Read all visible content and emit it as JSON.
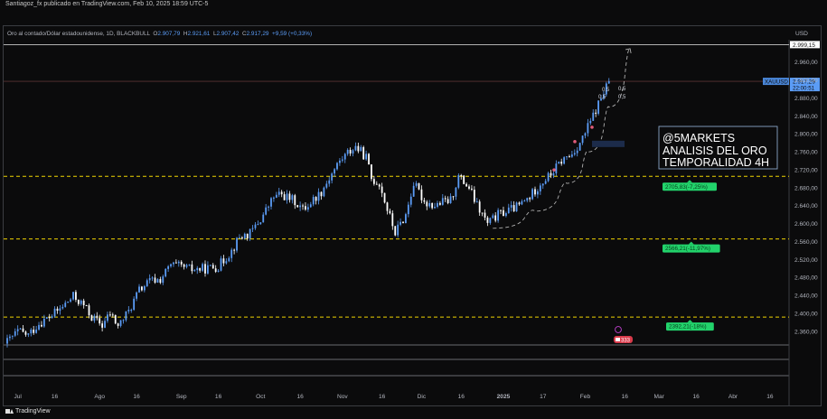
{
  "header": {
    "credit": "Santiagoz_fx publicado en TradingView.com, Feb 10, 2025 18:59 UTC-5"
  },
  "legend": {
    "symbol": "Oro al contado/Dólar estadounidense, 1D, BLACKBULL",
    "open_label": "O",
    "open": "2.907,79",
    "high_label": "H",
    "high": "2.921,61",
    "low_label": "L",
    "low": "2.907,42",
    "close_label": "C",
    "close": "2.917,29",
    "change": "+9,59 (+0,33%)"
  },
  "footer": {
    "brand": "TradingView"
  },
  "chart_data": {
    "type": "candlestick",
    "currency": "USD",
    "ylim": [
      2330,
      3010
    ],
    "y_ticks": [
      {
        "value": 2360,
        "label": "2.360,00"
      },
      {
        "value": 2400,
        "label": "2.400,00"
      },
      {
        "value": 2440,
        "label": "2.440,00"
      },
      {
        "value": 2480,
        "label": "2.480,00"
      },
      {
        "value": 2520,
        "label": "2.520,00"
      },
      {
        "value": 2560,
        "label": "2.560,00"
      },
      {
        "value": 2600,
        "label": "2.600,00"
      },
      {
        "value": 2640,
        "label": "2.640,00"
      },
      {
        "value": 2680,
        "label": "2.680,00"
      },
      {
        "value": 2720,
        "label": "2.720,00"
      },
      {
        "value": 2760,
        "label": "2.760,00"
      },
      {
        "value": 2800,
        "label": "2.800,00"
      },
      {
        "value": 2840,
        "label": "2.840,00"
      },
      {
        "value": 2880,
        "label": "2.880,00"
      },
      {
        "value": 2920,
        "label": "2.920,00"
      },
      {
        "value": 2960,
        "label": "2.960,00"
      }
    ],
    "x_ticks": [
      {
        "day": 4,
        "label": "Jul"
      },
      {
        "day": 18,
        "label": "16"
      },
      {
        "day": 35,
        "label": "Ago"
      },
      {
        "day": 49,
        "label": "16"
      },
      {
        "day": 66,
        "label": "Sep"
      },
      {
        "day": 80,
        "label": "16"
      },
      {
        "day": 96,
        "label": "Oct"
      },
      {
        "day": 111,
        "label": "16"
      },
      {
        "day": 127,
        "label": "Nov"
      },
      {
        "day": 142,
        "label": "16"
      },
      {
        "day": 157,
        "label": "Dic"
      },
      {
        "day": 172,
        "label": "16"
      },
      {
        "day": 188,
        "label": "2025"
      },
      {
        "day": 203,
        "label": "17"
      },
      {
        "day": 219,
        "label": "Feb"
      },
      {
        "day": 234,
        "label": "16"
      },
      {
        "day": 247,
        "label": "Mar"
      },
      {
        "day": 261,
        "label": "16"
      },
      {
        "day": 275,
        "label": "Abr"
      },
      {
        "day": 289,
        "label": "16"
      }
    ],
    "anchors": [
      {
        "day": 0,
        "price": 2337
      },
      {
        "day": 4,
        "price": 2360
      },
      {
        "day": 8,
        "price": 2352
      },
      {
        "day": 12,
        "price": 2378
      },
      {
        "day": 16,
        "price": 2392
      },
      {
        "day": 20,
        "price": 2410
      },
      {
        "day": 25,
        "price": 2438
      },
      {
        "day": 29,
        "price": 2418
      },
      {
        "day": 32,
        "price": 2392
      },
      {
        "day": 36,
        "price": 2374
      },
      {
        "day": 39,
        "price": 2400
      },
      {
        "day": 42,
        "price": 2372
      },
      {
        "day": 46,
        "price": 2405
      },
      {
        "day": 50,
        "price": 2452
      },
      {
        "day": 54,
        "price": 2472
      },
      {
        "day": 58,
        "price": 2476
      },
      {
        "day": 62,
        "price": 2508
      },
      {
        "day": 65,
        "price": 2505
      },
      {
        "day": 70,
        "price": 2498
      },
      {
        "day": 75,
        "price": 2500
      },
      {
        "day": 80,
        "price": 2505
      },
      {
        "day": 85,
        "price": 2540
      },
      {
        "day": 88,
        "price": 2570
      },
      {
        "day": 92,
        "price": 2578
      },
      {
        "day": 96,
        "price": 2610
      },
      {
        "day": 101,
        "price": 2660
      },
      {
        "day": 104,
        "price": 2665
      },
      {
        "day": 109,
        "price": 2650
      },
      {
        "day": 112,
        "price": 2632
      },
      {
        "day": 115,
        "price": 2648
      },
      {
        "day": 119,
        "price": 2672
      },
      {
        "day": 123,
        "price": 2712
      },
      {
        "day": 126,
        "price": 2740
      },
      {
        "day": 129,
        "price": 2758
      },
      {
        "day": 132,
        "price": 2772
      },
      {
        "day": 136,
        "price": 2748
      },
      {
        "day": 138,
        "price": 2700
      },
      {
        "day": 141,
        "price": 2690
      },
      {
        "day": 144,
        "price": 2632
      },
      {
        "day": 147,
        "price": 2580
      },
      {
        "day": 151,
        "price": 2620
      },
      {
        "day": 154,
        "price": 2690
      },
      {
        "day": 158,
        "price": 2650
      },
      {
        "day": 162,
        "price": 2640
      },
      {
        "day": 165,
        "price": 2648
      },
      {
        "day": 168,
        "price": 2652
      },
      {
        "day": 171,
        "price": 2705
      },
      {
        "day": 175,
        "price": 2680
      },
      {
        "day": 178,
        "price": 2640
      },
      {
        "day": 182,
        "price": 2600
      },
      {
        "day": 186,
        "price": 2620
      },
      {
        "day": 190,
        "price": 2630
      },
      {
        "day": 194,
        "price": 2640
      },
      {
        "day": 198,
        "price": 2660
      },
      {
        "day": 202,
        "price": 2690
      },
      {
        "day": 206,
        "price": 2710
      },
      {
        "day": 210,
        "price": 2740
      },
      {
        "day": 214,
        "price": 2755
      },
      {
        "day": 218,
        "price": 2790
      },
      {
        "day": 222,
        "price": 2840
      },
      {
        "day": 225,
        "price": 2880
      },
      {
        "day": 228,
        "price": 2917
      }
    ],
    "horizontal_levels": [
      {
        "price": 2705.83,
        "label": "2705,83(-7,25%)",
        "style": "dashed",
        "color": "#f0d400"
      },
      {
        "price": 2566.21,
        "label": "2566,21(-11,97%)",
        "style": "dashed",
        "color": "#f0d400"
      },
      {
        "price": 2392.21,
        "label": "2392,21(-18%)",
        "style": "dashed",
        "color": "#f0d400"
      },
      {
        "price": 2999.15,
        "label": "2.999,15",
        "style": "solid",
        "color": "#c8c8c8"
      },
      {
        "price": 2917.29,
        "label": "2.917,29",
        "style": "solid",
        "color": "#5b3333"
      }
    ],
    "price_tags": {
      "symbol": "XAUUSD",
      "last_price": "2.917,29",
      "countdown": "22:00:51",
      "target": "2.999,15"
    },
    "annotations": {
      "box_title": "@5MARKETS",
      "box_line2": "ANALISIS DEL ORO",
      "box_line3": "TEMPORALIDAD 4H",
      "fib_labels": [
        "0,5",
        "0,5",
        "0,5",
        "0,5"
      ],
      "event_badge": "333"
    },
    "curve": [
      {
        "day": 184,
        "price": 2590
      },
      {
        "day": 200,
        "price": 2628
      },
      {
        "day": 212,
        "price": 2690
      },
      {
        "day": 220,
        "price": 2760
      },
      {
        "day": 228,
        "price": 2860
      },
      {
        "day": 236,
        "price": 2990
      }
    ],
    "colors": {
      "candle_up": "#5b9cf6",
      "candle_down": "#ffffff",
      "level": "#f0d400",
      "label_bg": "#22d36b",
      "last_price_bg": "#5b9cf6",
      "background": "#0b0b0c"
    }
  }
}
